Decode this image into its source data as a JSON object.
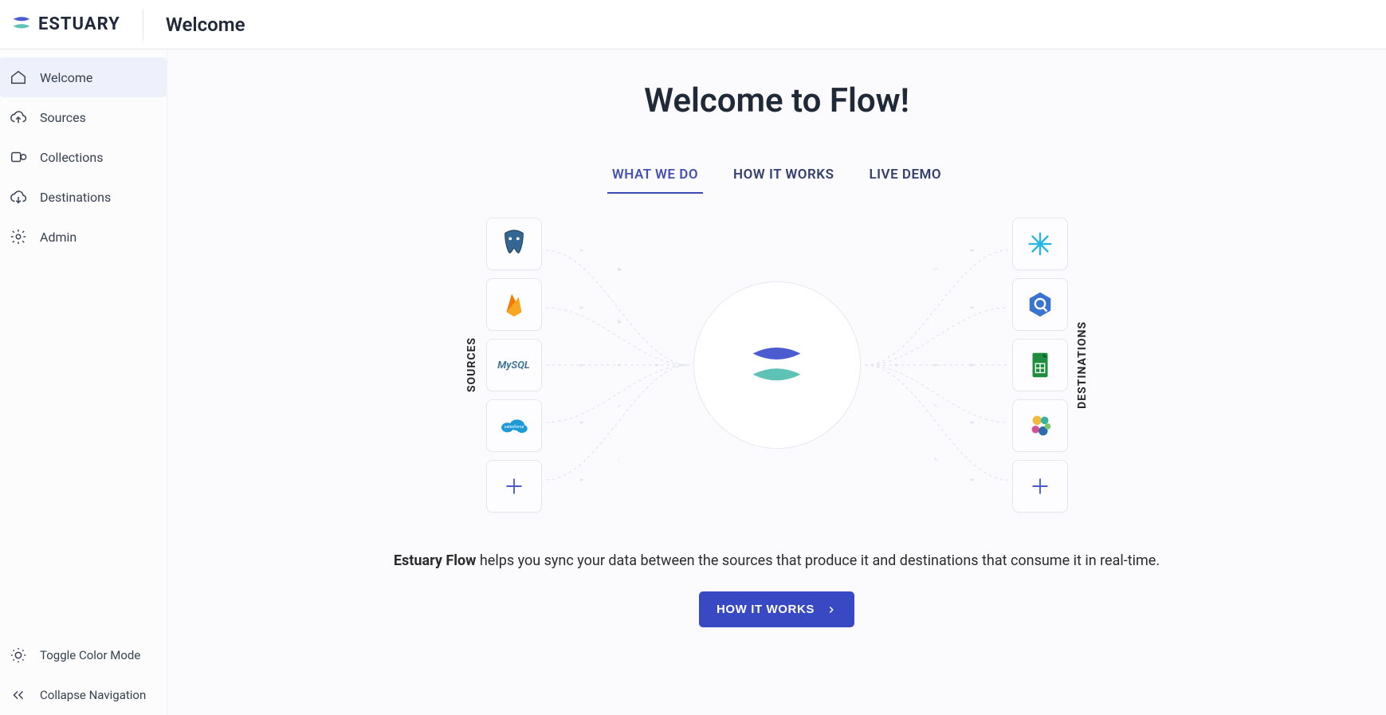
{
  "header": {
    "brand": "ESTUARY",
    "title": "Welcome"
  },
  "sidebar": {
    "items": [
      {
        "label": "Welcome",
        "active": true
      },
      {
        "label": "Sources",
        "active": false
      },
      {
        "label": "Collections",
        "active": false
      },
      {
        "label": "Destinations",
        "active": false
      },
      {
        "label": "Admin",
        "active": false
      }
    ],
    "footer": [
      {
        "label": "Toggle Color Mode"
      },
      {
        "label": "Collapse Navigation"
      }
    ]
  },
  "main": {
    "hero": "Welcome to Flow!",
    "tabs": [
      {
        "label": "WHAT WE DO",
        "active": true
      },
      {
        "label": "HOW IT WORKS",
        "active": false
      },
      {
        "label": "LIVE DEMO",
        "active": false
      }
    ],
    "diagram": {
      "sources_label": "SOURCES",
      "destinations_label": "DESTINATIONS",
      "sources": [
        "postgresql",
        "firebase",
        "mysql",
        "salesforce",
        "add"
      ],
      "destinations": [
        "snowflake",
        "bigquery",
        "google-sheets",
        "elastic",
        "add"
      ]
    },
    "desc_bold": "Estuary Flow",
    "desc_rest": " helps you sync your data between the sources that produce it and destinations that consume it in real-time.",
    "cta": "HOW IT WORKS"
  }
}
